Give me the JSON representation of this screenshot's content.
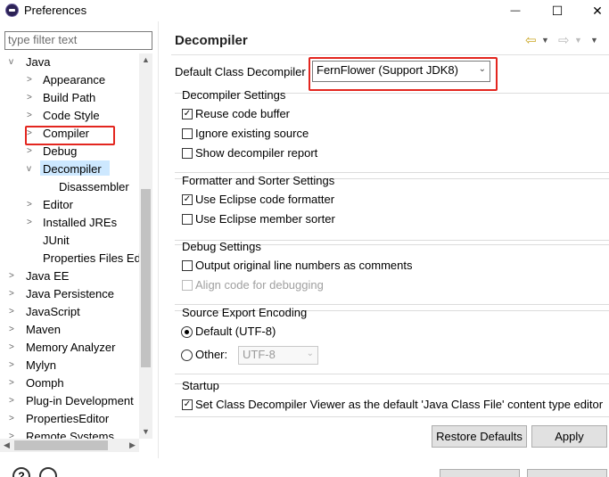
{
  "window": {
    "title": "Preferences",
    "controls": {
      "minimize": "—",
      "maximize": "☐",
      "close": "✕"
    }
  },
  "sidebar": {
    "filter_placeholder": "type filter text",
    "items": [
      {
        "label": "Java",
        "expanded": true
      },
      {
        "label": "Appearance"
      },
      {
        "label": "Build Path"
      },
      {
        "label": "Code Style"
      },
      {
        "label": "Compiler"
      },
      {
        "label": "Debug"
      },
      {
        "label": "Decompiler",
        "expanded": true,
        "selected": true
      },
      {
        "label": "Disassembler"
      },
      {
        "label": "Editor"
      },
      {
        "label": "Installed JREs"
      },
      {
        "label": "JUnit"
      },
      {
        "label": "Properties Files Ed"
      },
      {
        "label": "Java EE"
      },
      {
        "label": "Java Persistence"
      },
      {
        "label": "JavaScript"
      },
      {
        "label": "Maven"
      },
      {
        "label": "Memory Analyzer"
      },
      {
        "label": "Mylyn"
      },
      {
        "label": "Oomph"
      },
      {
        "label": "Plug-in Development"
      },
      {
        "label": "PropertiesEditor"
      },
      {
        "label": "Remote Systems"
      }
    ]
  },
  "page": {
    "title": "Decompiler",
    "default_decompiler_label": "Default Class Decompiler",
    "default_decompiler_value": "FernFlower (Support JDK8)",
    "groups": {
      "decompiler_settings": {
        "title": "Decompiler Settings",
        "options": [
          {
            "label": "Reuse code buffer",
            "checked": true
          },
          {
            "label": "Ignore existing source",
            "checked": false
          },
          {
            "label": "Show decompiler report",
            "checked": false
          }
        ]
      },
      "formatter": {
        "title": "Formatter and Sorter Settings",
        "options": [
          {
            "label": "Use Eclipse code formatter",
            "checked": true
          },
          {
            "label": "Use Eclipse member sorter",
            "checked": false
          }
        ]
      },
      "debug": {
        "title": "Debug Settings",
        "options": [
          {
            "label": "Output original line numbers as comments",
            "checked": false
          },
          {
            "label": "Align code for debugging",
            "checked": false,
            "disabled": true
          }
        ]
      },
      "encoding": {
        "title": "Source Export Encoding",
        "default_label": "Default (UTF-8)",
        "other_label": "Other:",
        "other_value": "UTF-8"
      },
      "startup": {
        "title": "Startup",
        "option": "Set Class Decompiler Viewer as the default 'Java Class File' content type editor",
        "checked": true
      }
    },
    "buttons": {
      "restore_defaults": "Restore Defaults",
      "apply": "Apply"
    }
  },
  "colors": {
    "highlight": "#e3261f",
    "selection": "#cde8ff"
  },
  "icons": [
    "back-arrow-icon",
    "forward-arrow-icon",
    "menu-chevron-icon",
    "help-icon",
    "info-icon"
  ]
}
